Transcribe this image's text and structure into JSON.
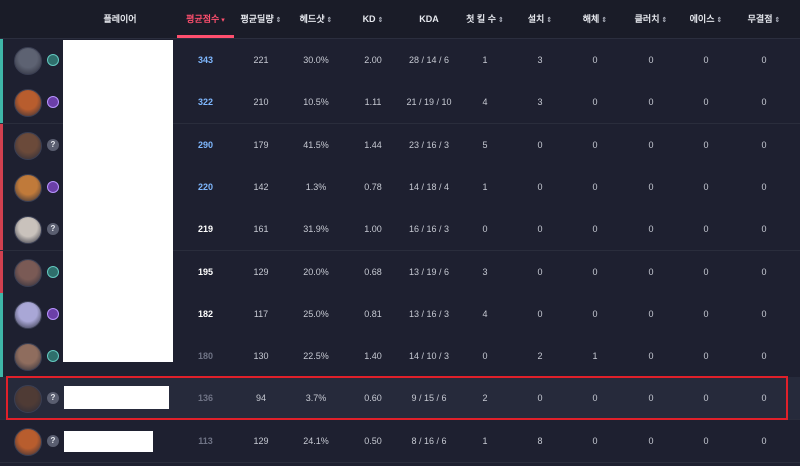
{
  "columns": [
    {
      "key": "player",
      "label": "플레이어",
      "arrow": ""
    },
    {
      "key": "score",
      "label": "평균점수",
      "arrow": "▾"
    },
    {
      "key": "damage",
      "label": "평균딜량",
      "arrow": "⇕"
    },
    {
      "key": "hs",
      "label": "헤드샷",
      "arrow": "⇕"
    },
    {
      "key": "kd",
      "label": "KD",
      "arrow": "⇕"
    },
    {
      "key": "kda",
      "label": "KDA",
      "arrow": ""
    },
    {
      "key": "fb",
      "label": "첫 킬 수",
      "arrow": "⇕"
    },
    {
      "key": "plant",
      "label": "설치",
      "arrow": "⇕"
    },
    {
      "key": "defuse",
      "label": "해체",
      "arrow": "⇕"
    },
    {
      "key": "clutch",
      "label": "클러치",
      "arrow": "⇕"
    },
    {
      "key": "ace",
      "label": "에이스",
      "arrow": "⇕"
    },
    {
      "key": "flawless",
      "label": "무결점",
      "arrow": "⇕"
    }
  ],
  "colors": {
    "accent": "#ff4f6e",
    "score_blue": "#7fb8ff",
    "score_white": "#ffffff",
    "score_gray": "#6f7385",
    "stripe_teal": "#3fb6a8",
    "stripe_red": "#d1404f",
    "highlight": "#e0202a"
  },
  "rows": [
    {
      "avatar": "agent-avatar-1",
      "avatar_color": "#5d6272",
      "rank": "teal",
      "stripe": "teal",
      "score": "343",
      "score_tone": "blue",
      "damage": "221",
      "hs": "30.0%",
      "kd": "2.00",
      "kda": "28 / 14 / 6",
      "fb": "1",
      "plant": "3",
      "defuse": "0",
      "clutch": "0",
      "ace": "0",
      "flawless": "0"
    },
    {
      "avatar": "agent-avatar-2",
      "avatar_color": "#b85d2e",
      "rank": "purple",
      "stripe": "teal",
      "score": "322",
      "score_tone": "blue",
      "damage": "210",
      "hs": "10.5%",
      "kd": "1.11",
      "kda": "21 / 19 / 10",
      "fb": "4",
      "plant": "3",
      "defuse": "0",
      "clutch": "0",
      "ace": "0",
      "flawless": "0"
    },
    {
      "avatar": "agent-avatar-3",
      "avatar_color": "#6b4a3a",
      "rank": "q",
      "stripe": "red",
      "score": "290",
      "score_tone": "blue",
      "damage": "179",
      "hs": "41.5%",
      "kd": "1.44",
      "kda": "23 / 16 / 3",
      "fb": "5",
      "plant": "0",
      "defuse": "0",
      "clutch": "0",
      "ace": "0",
      "flawless": "0"
    },
    {
      "avatar": "agent-avatar-4",
      "avatar_color": "#c07a3a",
      "rank": "purple",
      "stripe": "red",
      "score": "220",
      "score_tone": "blue",
      "damage": "142",
      "hs": "1.3%",
      "kd": "0.78",
      "kda": "14 / 18 / 4",
      "fb": "1",
      "plant": "0",
      "defuse": "0",
      "clutch": "0",
      "ace": "0",
      "flawless": "0"
    },
    {
      "avatar": "agent-avatar-5",
      "avatar_color": "#c9c2bc",
      "rank": "q",
      "stripe": "red",
      "score": "219",
      "score_tone": "white",
      "damage": "161",
      "hs": "31.9%",
      "kd": "1.00",
      "kda": "16 / 16 / 3",
      "fb": "0",
      "plant": "0",
      "defuse": "0",
      "clutch": "0",
      "ace": "0",
      "flawless": "0"
    },
    {
      "avatar": "agent-avatar-6",
      "avatar_color": "#7a5a55",
      "rank": "teal",
      "stripe": "red",
      "score": "195",
      "score_tone": "white",
      "damage": "129",
      "hs": "20.0%",
      "kd": "0.68",
      "kda": "13 / 19 / 6",
      "fb": "3",
      "plant": "0",
      "defuse": "0",
      "clutch": "0",
      "ace": "0",
      "flawless": "0"
    },
    {
      "avatar": "agent-avatar-7",
      "avatar_color": "#a9a7d6",
      "rank": "purple",
      "stripe": "teal",
      "score": "182",
      "score_tone": "white",
      "damage": "117",
      "hs": "25.0%",
      "kd": "0.81",
      "kda": "13 / 16 / 3",
      "fb": "4",
      "plant": "0",
      "defuse": "0",
      "clutch": "0",
      "ace": "0",
      "flawless": "0"
    },
    {
      "avatar": "agent-avatar-8",
      "avatar_color": "#8f6d5e",
      "rank": "teal",
      "stripe": "teal",
      "score": "180",
      "score_tone": "gray",
      "damage": "130",
      "hs": "22.5%",
      "kd": "1.40",
      "kda": "14 / 10 / 3",
      "fb": "0",
      "plant": "2",
      "defuse": "1",
      "clutch": "0",
      "ace": "0",
      "flawless": "0"
    },
    {
      "avatar": "agent-avatar-9",
      "avatar_color": "#4f3b35",
      "rank": "q",
      "stripe": "",
      "score": "136",
      "score_tone": "gray",
      "damage": "94",
      "hs": "3.7%",
      "kd": "0.60",
      "kda": "9 / 15 / 6",
      "fb": "2",
      "plant": "0",
      "defuse": "0",
      "clutch": "0",
      "ace": "0",
      "flawless": "0"
    },
    {
      "avatar": "agent-avatar-10",
      "avatar_color": "#b85d2e",
      "rank": "q",
      "stripe": "",
      "score": "113",
      "score_tone": "gray",
      "damage": "129",
      "hs": "24.1%",
      "kd": "0.50",
      "kda": "8 / 16 / 6",
      "fb": "1",
      "plant": "8",
      "defuse": "0",
      "clutch": "0",
      "ace": "0",
      "flawless": "0"
    }
  ]
}
